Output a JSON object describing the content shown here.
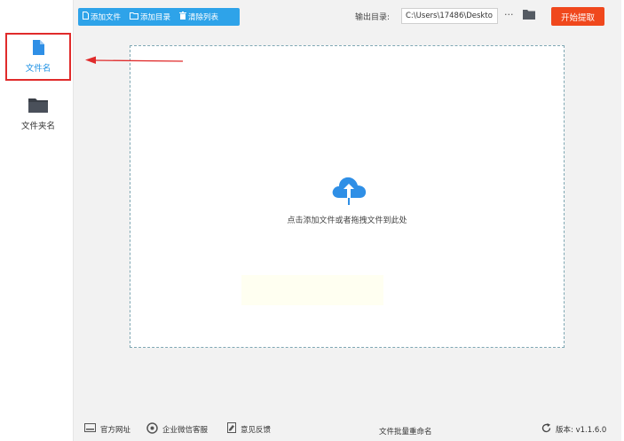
{
  "sidebar": {
    "items": [
      {
        "label": "文件名",
        "icon": "file-icon",
        "active": true
      },
      {
        "label": "文件夹名",
        "icon": "folder-icon",
        "active": false
      }
    ]
  },
  "toolbar": {
    "add_file": "添加文件",
    "add_dir": "添加目录",
    "clear_list": "清除列表",
    "output_label": "输出目录:",
    "output_path": "C:\\Users\\17486\\Deskto",
    "more": "···",
    "start": "开始提取"
  },
  "drop_zone": {
    "hint": "点击添加文件或者拖拽文件到此处"
  },
  "bottom": {
    "website": "官方网址",
    "wechat": "企业微信客服",
    "feedback": "意见反馈",
    "app_name": "文件批量重命名",
    "version": "版本: v1.1.6.0"
  },
  "colors": {
    "accent_blue": "#2ea3e9",
    "start_orange": "#f0481d",
    "highlight_red": "#e02b2b"
  }
}
